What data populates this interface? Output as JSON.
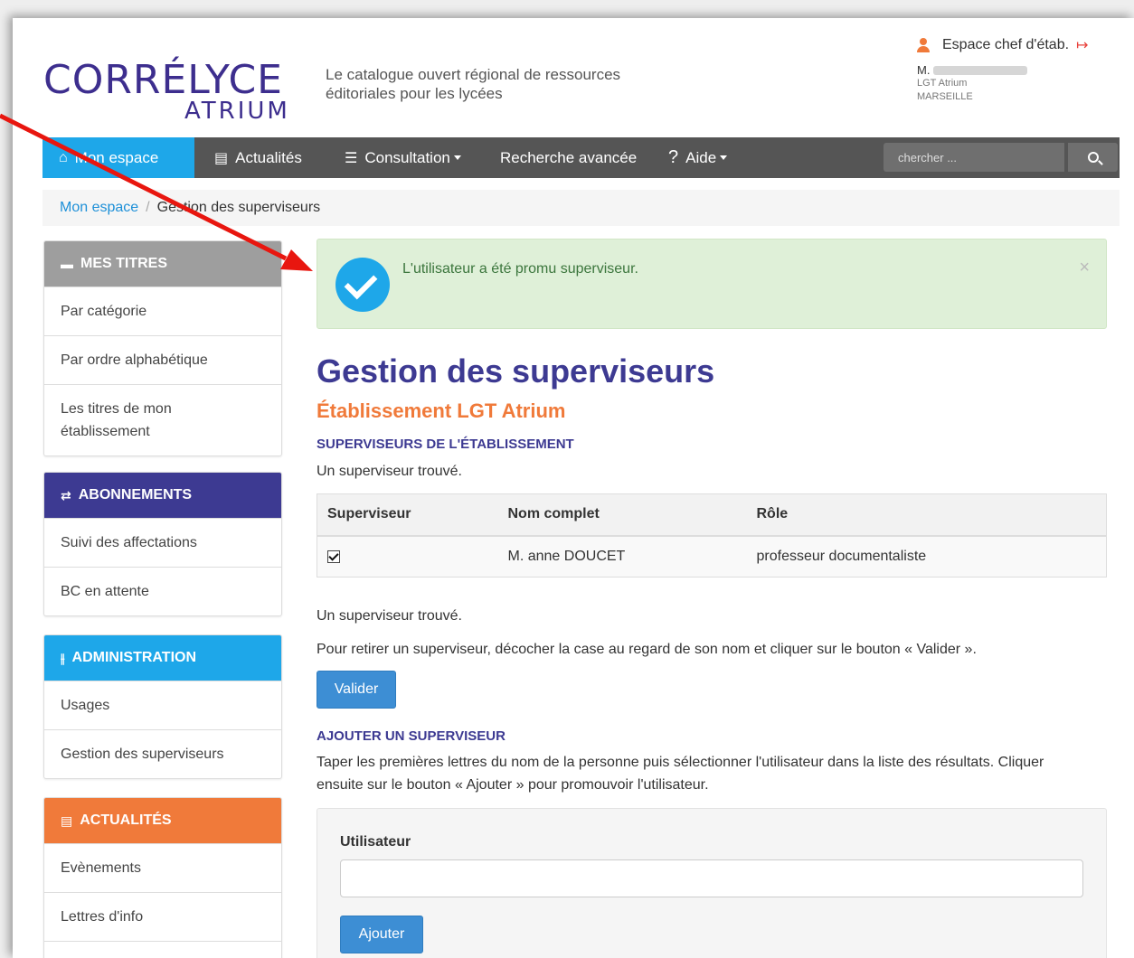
{
  "header": {
    "logo_main": "CORRÉLYCE",
    "logo_sub": "ATRIUM",
    "tagline_line1": "Le catalogue ouvert régional de ressources",
    "tagline_line2": "éditoriales pour les lycées",
    "user": {
      "space_label": "Espace chef d'étab.",
      "name_prefix": "M.",
      "establishment": "LGT Atrium",
      "city": "MARSEILLE"
    }
  },
  "nav": {
    "items": [
      {
        "label": "Mon espace",
        "icon": "home-icon"
      },
      {
        "label": "Actualités",
        "icon": "news-icon"
      },
      {
        "label": "Consultation",
        "icon": "list-icon"
      },
      {
        "label": "Recherche avancée"
      },
      {
        "label": "Aide",
        "icon": "question-icon"
      }
    ],
    "search_placeholder": "chercher ..."
  },
  "breadcrumb": {
    "home": "Mon espace",
    "separator": "/",
    "current": "Gestion des superviseurs"
  },
  "sidebar": {
    "mes_titres": {
      "title": "MES TITRES",
      "color": "#9e9e9e",
      "items": [
        "Par catégorie",
        "Par ordre alphabétique",
        "Les titres de mon établissement"
      ]
    },
    "abonnements": {
      "title": "ABONNEMENTS",
      "color": "#3d3a92",
      "items": [
        "Suivi des affectations",
        "BC en attente"
      ]
    },
    "administration": {
      "title": "ADMINISTRATION",
      "color": "#1ea7e9",
      "items": [
        "Usages",
        "Gestion des superviseurs"
      ]
    },
    "actualites": {
      "title": "ACTUALITÉS",
      "color": "#f07a3a",
      "items": [
        "Evènements",
        "Lettres d'info"
      ]
    }
  },
  "main": {
    "alert_text": "L'utilisateur a été promu superviseur.",
    "alert_close": "×",
    "title": "Gestion des superviseurs",
    "subtitle": "Établissement LGT Atrium",
    "section1_title": "SUPERVISEURS DE L'ÉTABLISSEMENT",
    "found_text": "Un superviseur trouvé.",
    "table": {
      "headers": [
        "Superviseur",
        "Nom complet",
        "Rôle"
      ],
      "rows": [
        {
          "checked": true,
          "name": "M. anne DOUCET",
          "role": "professeur documentaliste"
        }
      ]
    },
    "found_text_2": "Un superviseur trouvé.",
    "remove_instructions": "Pour retirer un superviseur, décocher la case au regard de son nom et cliquer sur le bouton « Valider ».",
    "validate_button": "Valider",
    "section2_title": "AJOUTER UN SUPERVISEUR",
    "add_instructions_line1": "Taper les premières lettres du nom de la personne puis sélectionner l'utilisateur dans la liste des résultats. Cliquer",
    "add_instructions_line2": "ensuite sur le bouton « Ajouter » pour promouvoir l'utilisateur.",
    "form": {
      "label": "Utilisateur",
      "value": "",
      "add_button": "Ajouter"
    }
  },
  "colors": {
    "accent_blue": "#1ea7e9",
    "brand_purple": "#3d3a92",
    "brand_orange": "#f07a3a",
    "annotation_red": "#e8160f"
  }
}
